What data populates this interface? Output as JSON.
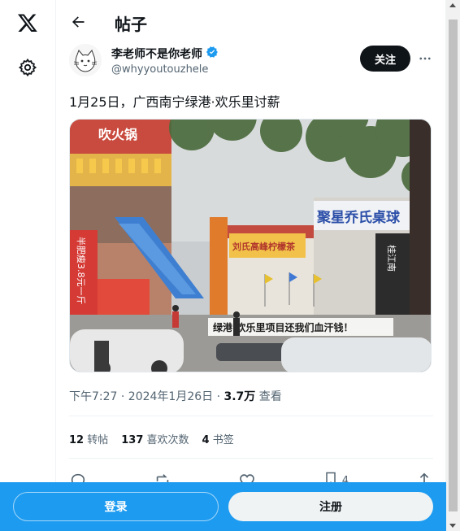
{
  "app": {
    "logo": "x-logo-icon",
    "settings_icon": "gear-icon"
  },
  "header": {
    "title": "帖子",
    "back_icon": "back-arrow-icon"
  },
  "author": {
    "name": "李老师不是你老师",
    "handle": "@whyyoutouzhele",
    "verified_icon": "verified-badge-icon",
    "follow_label": "关注",
    "more_icon": "more-icon"
  },
  "tweet": {
    "text": "1月25日，广西南宁绿港·欢乐里讨薪",
    "media": {
      "banner_text": "绿港·欢乐里项目还我们血汗钱！",
      "sign_left": "半肥瘦3.8元一斤",
      "sign_top": "吹火锅",
      "sign_right": "聚星乔氏桌球",
      "sign_middle": "刘氏高峰柠檬茶",
      "sign_tall": "桂江南"
    },
    "time": "下午7:27 · 2024年1月26日 ·",
    "views_count": "3.7万",
    "views_label": "查看"
  },
  "stats": {
    "retweets_count": "12",
    "retweets_label": "转帖",
    "likes_count": "137",
    "likes_label": "喜欢次数",
    "bookmarks_count": "4",
    "bookmarks_label": "书签"
  },
  "actions": {
    "reply_icon": "reply-icon",
    "retweet_icon": "retweet-icon",
    "like_icon": "heart-icon",
    "bookmark_icon": "bookmark-icon",
    "bookmark_count": "4",
    "share_icon": "share-icon"
  },
  "bottom_bar": {
    "login_label": "登录",
    "signup_label": "注册"
  },
  "colors": {
    "accent": "#1d9bf0",
    "text": "#0f1419",
    "secondary": "#536471"
  }
}
